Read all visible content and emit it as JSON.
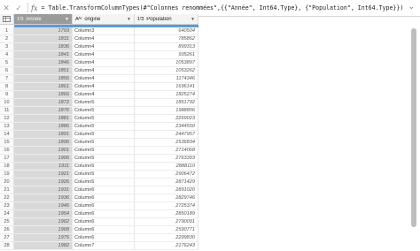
{
  "formula_bar": {
    "cancel_icon": "✕",
    "commit_icon": "✓",
    "fx_label": "fx",
    "formula": "= Table.TransformColumnTypes(#\"Colonnes renommées\",{{\"Année\", Int64.Type}, {\"Population\", Int64.Type}})",
    "expand_icon": "⌄"
  },
  "columns": [
    {
      "type_icon": "1²3",
      "label": "Année"
    },
    {
      "type_icon": "Aᴬᶜ",
      "label": "origine"
    },
    {
      "type_icon": "1²3",
      "label": "Population"
    }
  ],
  "rows": [
    {
      "n": "1",
      "year": "1793",
      "origin": "Column3",
      "pop": "640504"
    },
    {
      "n": "2",
      "year": "1831",
      "origin": "Column4",
      "pop": "785862"
    },
    {
      "n": "3",
      "year": "1836",
      "origin": "Column4",
      "pop": "899313"
    },
    {
      "n": "4",
      "year": "1841",
      "origin": "Column4",
      "pop": "935261"
    },
    {
      "n": "5",
      "year": "1846",
      "origin": "Column4",
      "pop": "1053897"
    },
    {
      "n": "6",
      "year": "1851",
      "origin": "Column4",
      "pop": "1053262"
    },
    {
      "n": "7",
      "year": "1856",
      "origin": "Column4",
      "pop": "1174346"
    },
    {
      "n": "8",
      "year": "1861",
      "origin": "Column4",
      "pop": "1696141"
    },
    {
      "n": "9",
      "year": "1866",
      "origin": "Column4",
      "pop": "1825274"
    },
    {
      "n": "10",
      "year": "1872",
      "origin": "Column5",
      "pop": "1851792"
    },
    {
      "n": "11",
      "year": "1876",
      "origin": "Column5",
      "pop": "1988806"
    },
    {
      "n": "12",
      "year": "1881",
      "origin": "Column5",
      "pop": "2269023"
    },
    {
      "n": "13",
      "year": "1886",
      "origin": "Column5",
      "pop": "2344550"
    },
    {
      "n": "14",
      "year": "1891",
      "origin": "Column5",
      "pop": "2447957"
    },
    {
      "n": "15",
      "year": "1896",
      "origin": "Column5",
      "pop": "2536834"
    },
    {
      "n": "16",
      "year": "1901",
      "origin": "Column5",
      "pop": "2714068"
    },
    {
      "n": "17",
      "year": "1906",
      "origin": "Column5",
      "pop": "2763393"
    },
    {
      "n": "18",
      "year": "1911",
      "origin": "Column5",
      "pop": "2888110"
    },
    {
      "n": "19",
      "year": "1921",
      "origin": "Column5",
      "pop": "2906472"
    },
    {
      "n": "20",
      "year": "1926",
      "origin": "Column5",
      "pop": "2871429"
    },
    {
      "n": "21",
      "year": "1931",
      "origin": "Column6",
      "pop": "2891020"
    },
    {
      "n": "22",
      "year": "1936",
      "origin": "Column6",
      "pop": "2829746"
    },
    {
      "n": "23",
      "year": "1946",
      "origin": "Column6",
      "pop": "2725374"
    },
    {
      "n": "24",
      "year": "1954",
      "origin": "Column6",
      "pop": "2850189"
    },
    {
      "n": "25",
      "year": "1962",
      "origin": "Column6",
      "pop": "2790091"
    },
    {
      "n": "26",
      "year": "1968",
      "origin": "Column6",
      "pop": "2590771"
    },
    {
      "n": "27",
      "year": "1975",
      "origin": "Column6",
      "pop": "2299830"
    },
    {
      "n": "28",
      "year": "1982",
      "origin": "Column7",
      "pop": "2176243"
    }
  ],
  "colors": {
    "quality_bar": "#5b9bd5",
    "selected_header": "#9b9b9b",
    "selected_column": "#d9d9d9"
  }
}
